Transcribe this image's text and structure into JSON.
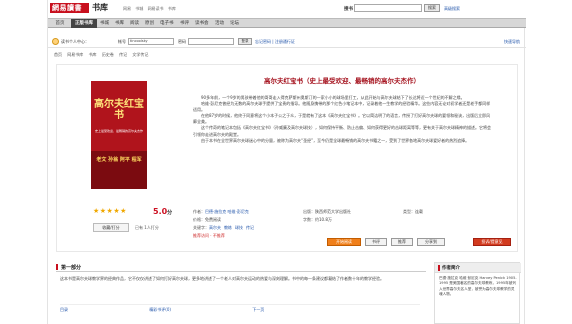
{
  "site": {
    "logo": "網易讀書",
    "title": "书库"
  },
  "top_links": [
    "网易",
    "书城",
    "网易读书",
    "书库"
  ],
  "search": {
    "label": "搜书",
    "button": "搜索",
    "advanced": "高级搜索"
  },
  "nav": {
    "home": "首页",
    "active": "正版书库",
    "items": [
      "书城",
      "书库",
      "阅读",
      "原创",
      "电子书",
      "书评",
      "读书会",
      "活动",
      "论坛"
    ]
  },
  "login": {
    "prompt": "读书个人中心：",
    "account_label": "帐号",
    "account_value": "tincoolsky",
    "password_label": "密码",
    "button": "登录",
    "links": "忘记密码 | 注册通行证",
    "quick_nav": "快速导航"
  },
  "breadcrumb": [
    "首页",
    "网易书库",
    "书库",
    "历史卷",
    "传记",
    "文学传记"
  ],
  "book": {
    "title": "高尔夫红宝书（史上最受欢迎、最畅销的高尔夫杰作）",
    "cover_title": "高尔夫红宝书",
    "cover_subtitle": "史上最受欢迎、最畅销的高尔夫杰作",
    "cover_names": "老文 孙翁 阿平 程军",
    "rating_stars": "★★★★★",
    "score": "5.0",
    "score_suffix": "分",
    "description": [
      "90多年前，一个9岁的男孩带着他的哥哥走入得克萨斯州奥斯汀的一家小小的球场里打工，从此开始与高尔夫球结下了长达将近一个世纪的不解之缘。",
      "哈维·彭尼克曾经为无数的高尔夫球手提供了宝贵的指导。他随身携带的那个红色小笔记本中，记录着他一生教学的经验精华。这些内容无论对初学者还是老手都同样适用。",
      "在他87岁的时候，他终于同意将这个小本子公之于众，于是就有了这本《高尔夫红宝书》。它以简洁明了的语言，传授了打好高尔夫球的要领和秘诀，出版后立即风靡全美。",
      "这个传奇的笔记本包括《高尔夫红宝书》（孙威廉及高尔夫球技），如何保持平衡、防止击偏、如何获得更好的击球距离等等，更有关于高尔夫球精神的描述。它将会引领你走进高尔夫的殿堂。",
      "由于本书在全世界高尔夫球迷心中的分量，被称为高尔夫“圣经”，至今仍是全球最畅销的高尔夫书籍之一，受到了世界各地高尔夫球爱好者的热烈追捧。"
    ],
    "meta": {
      "author_label": "作者：",
      "author": "巴德·施拉克 哈维·彭尼克",
      "publisher_label": "出版：",
      "publisher": "陕西师范大学出版社",
      "category_label": "类型：",
      "category": "连载",
      "price_label": "价格：",
      "price": "免费阅读",
      "words_label": "字数：",
      "words": "约10.8万",
      "tags_label": "关键字：",
      "tags": [
        "高尔夫",
        "教练",
        "球技",
        "传记"
      ],
      "notice": "推荐访问 · 不推荐",
      "fav_button": "收藏/打分",
      "count_text": "已有 1人打分"
    },
    "actions": {
      "read": "开始阅读",
      "comment": "书评",
      "recommend": "推荐",
      "share": "分享到",
      "gift": "投诉/提意见"
    }
  },
  "bottom": {
    "section_title": "第一部分",
    "section_text": "这本书是高尔夫球教学界的经典作品，它不仅仅讲述了如何打好高尔夫球，更多地讲述了一个老人对高尔夫运动的热爱与深刻理解。书中的每一条建议都凝结了作者数十年的教学经验。",
    "links": [
      "目录",
      "精彩书评(0)",
      "下一页"
    ]
  },
  "author_box": {
    "title": "作者简介",
    "body": "巴德·施拉克 哈维·彭尼克 Harvey Penick 1905-1995 是美国著名的高尔夫球教练，1995年被列入世界高尔夫名人堂，被誉为高尔夫球教学的灵魂人物。"
  }
}
